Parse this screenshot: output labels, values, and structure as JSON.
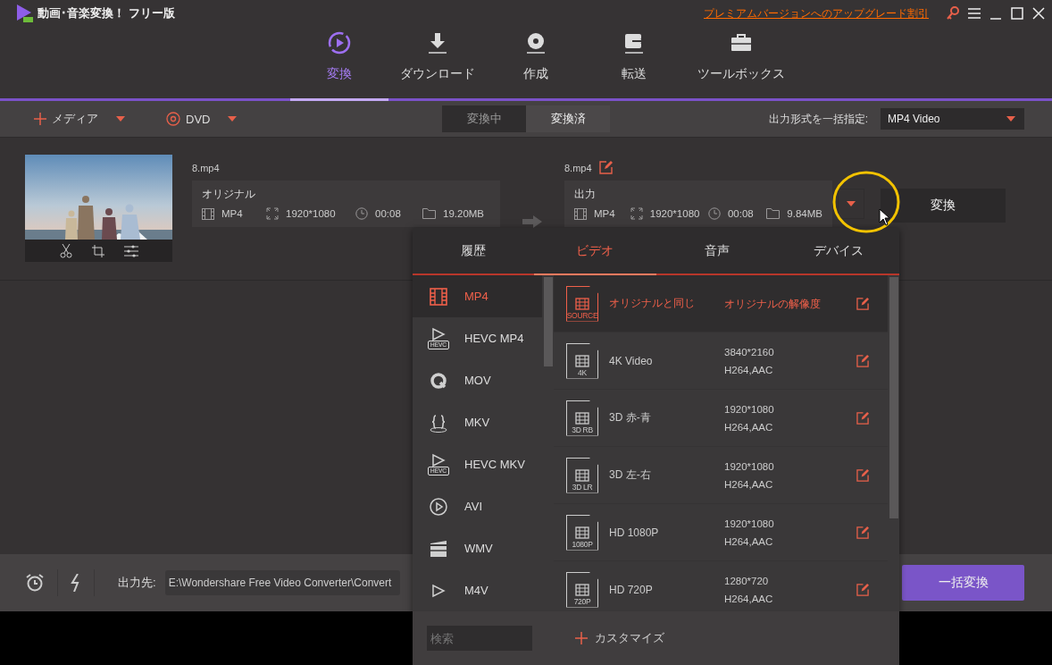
{
  "app": {
    "title": "動画･音楽変換！ フリー版",
    "upgrade_link": "プレミアムバージョンへのアップグレード割引"
  },
  "nav_tabs": [
    {
      "label": "変換",
      "kind": "convert",
      "selected": true
    },
    {
      "label": "ダウンロード",
      "kind": "download",
      "selected": false
    },
    {
      "label": "作成",
      "kind": "disc",
      "selected": false
    },
    {
      "label": "転送",
      "kind": "transfer",
      "selected": false
    },
    {
      "label": "ツールボックス",
      "kind": "toolbox",
      "selected": false
    }
  ],
  "toolbar": {
    "add_media": "メディア",
    "dvd": "DVD",
    "status_tabs": [
      {
        "label": "変換中",
        "selected": true
      },
      {
        "label": "変換済",
        "selected": false
      }
    ],
    "format_label": "出力形式を一括指定:",
    "format_value": "MP4 Video"
  },
  "file": {
    "source_name": "8.mp4",
    "original": {
      "label": "オリジナル",
      "format": "MP4",
      "resolution": "1920*1080",
      "duration": "00:08",
      "size": "19.20MB"
    },
    "output_name": "8.mp4",
    "output": {
      "label": "出力",
      "format": "MP4",
      "resolution": "1920*1080",
      "duration": "00:08",
      "size": "9.84MB"
    },
    "convert_button": "変換"
  },
  "bottom": {
    "output_label": "出力先:",
    "output_path": "E:\\Wondershare Free Video Converter\\Convert",
    "convert_all_button": "一括変換"
  },
  "format_popup": {
    "tabs": [
      {
        "label": "履歴",
        "selected": false
      },
      {
        "label": "ビデオ",
        "selected": true
      },
      {
        "label": "音声",
        "selected": false
      },
      {
        "label": "デバイス",
        "selected": false
      }
    ],
    "formats": [
      {
        "label": "MP4",
        "kind": "film",
        "selected": true
      },
      {
        "label": "HEVC MP4",
        "kind": "hevc",
        "badge": "HEVC",
        "selected": false
      },
      {
        "label": "MOV",
        "kind": "quicktime",
        "selected": false
      },
      {
        "label": "MKV",
        "kind": "braces",
        "selected": false
      },
      {
        "label": "HEVC MKV",
        "kind": "hevc",
        "badge": "HEVC",
        "selected": false
      },
      {
        "label": "AVI",
        "kind": "play",
        "selected": false
      },
      {
        "label": "WMV",
        "kind": "clapper",
        "selected": false
      },
      {
        "label": "M4V",
        "kind": "hevc",
        "selected": false
      }
    ],
    "presets": [
      {
        "name": "オリジナルと同じ",
        "badge": "SOURCE",
        "resolution": "オリジナルの解像度",
        "selected": true
      },
      {
        "name": "4K Video",
        "badge": "4K",
        "resolution": "3840*2160",
        "codec": "H264,AAC",
        "selected": false
      },
      {
        "name": "3D 赤-青",
        "badge": "3D RB",
        "resolution": "1920*1080",
        "codec": "H264,AAC",
        "selected": false
      },
      {
        "name": "3D 左-右",
        "badge": "3D LR",
        "resolution": "1920*1080",
        "codec": "H264,AAC",
        "selected": false
      },
      {
        "name": "HD 1080P",
        "badge": "1080P",
        "resolution": "1920*1080",
        "codec": "H264,AAC",
        "selected": false
      },
      {
        "name": "HD 720P",
        "badge": "720P",
        "resolution": "1280*720",
        "codec": "H264,AAC",
        "selected": false
      }
    ],
    "search": {
      "placeholder": "検索"
    },
    "customize": "カスタマイズ"
  }
}
